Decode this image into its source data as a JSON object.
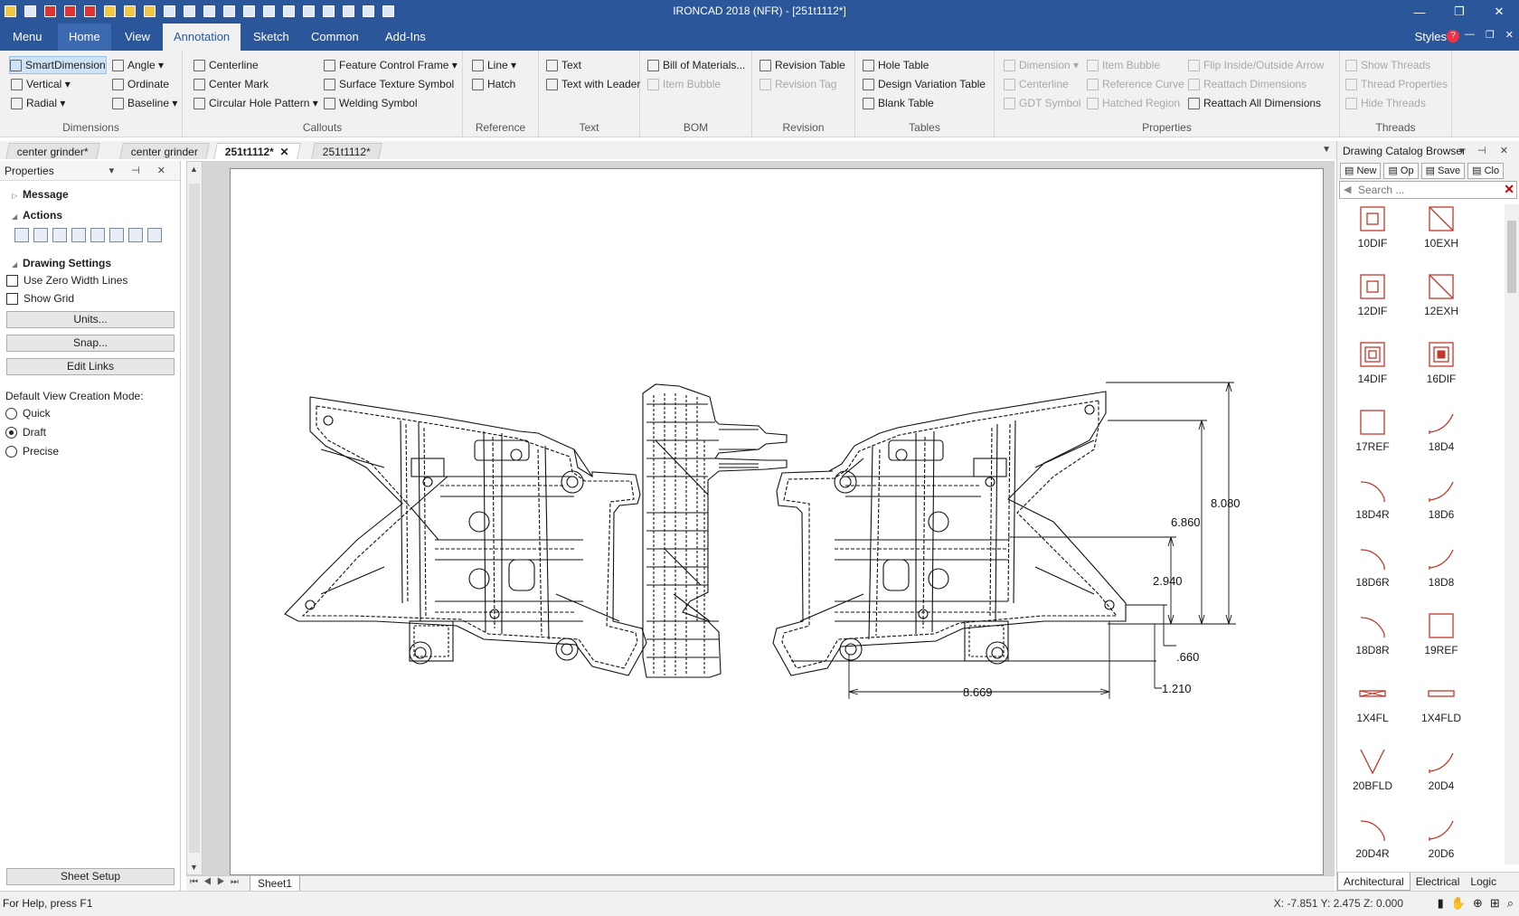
{
  "window": {
    "title": "IRONCAD 2018 (NFR) - [251t1112*]",
    "controls": [
      "—",
      "❐",
      "✕"
    ]
  },
  "menubar": {
    "tabs": [
      "Menu",
      "Home",
      "View",
      "Annotation",
      "Sketch",
      "Common",
      "Add-Ins"
    ],
    "active": "Annotation",
    "styles": "Styles",
    "help": "?",
    "mdi": [
      "—",
      "❐",
      "✕"
    ]
  },
  "ribbon": {
    "dimensions": {
      "label": "Dimensions",
      "items": [
        "SmartDimension",
        "Vertical",
        "Radial",
        "Angle",
        "Ordinate",
        "Baseline"
      ]
    },
    "callouts": {
      "label": "Callouts",
      "items": [
        "Centerline",
        "Center Mark",
        "Circular Hole Pattern",
        "Feature Control Frame",
        "Surface Texture Symbol",
        "Welding Symbol"
      ]
    },
    "reference": {
      "label": "Reference",
      "items": [
        "Line",
        "Hatch"
      ]
    },
    "text": {
      "label": "Text",
      "items": [
        "Text",
        "Text with Leader"
      ]
    },
    "bom": {
      "label": "BOM",
      "items": [
        "Bill of Materials...",
        "Item Bubble"
      ]
    },
    "revision": {
      "label": "Revision",
      "items": [
        "Revision Table",
        "Revision Tag"
      ]
    },
    "tables": {
      "label": "Tables",
      "items": [
        "Hole Table",
        "Design Variation Table",
        "Blank Table"
      ]
    },
    "properties": {
      "label": "Properties",
      "items": [
        "Dimension",
        "Centerline",
        "GDT Symbol",
        "Item Bubble",
        "Reference Curve",
        "Hatched Region",
        "Flip Inside/Outside Arrow",
        "Reattach Dimensions",
        "Reattach All Dimensions"
      ]
    },
    "threads": {
      "label": "Threads",
      "items": [
        "Show Threads",
        "Thread Properties",
        "Hide Threads"
      ]
    }
  },
  "doctabs": [
    "center grinder*",
    "center grinder",
    "251t1112*",
    "251t1112*"
  ],
  "properties": {
    "title": "Properties",
    "message": "Message",
    "actions": "Actions",
    "drawing_settings": "Drawing Settings",
    "use_zero_width": "Use Zero Width Lines",
    "show_grid": "Show Grid",
    "units_btn": "Units...",
    "snap_btn": "Snap...",
    "edit_links_btn": "Edit Links",
    "default_view_label": "Default View Creation Mode:",
    "modes": [
      "Quick",
      "Draft",
      "Precise"
    ],
    "selected_mode": "Draft",
    "sheet_setup_btn": "Sheet Setup"
  },
  "drawing": {
    "dims": [
      "8.080",
      "6.860",
      "2.940",
      ".660",
      "1.210",
      "8.669"
    ],
    "sheet_tab": "Sheet1"
  },
  "catalog": {
    "title": "Drawing Catalog Browser",
    "tools": [
      "New",
      "Op",
      "Save",
      "Clo"
    ],
    "search_placeholder": "Search ...",
    "items": [
      "10DIF",
      "10EXH",
      "12DIF",
      "12EXH",
      "14DIF",
      "16DIF",
      "17REF",
      "18D4",
      "18D4R",
      "18D6",
      "18D6R",
      "18D8",
      "18D8R",
      "19REF",
      "1X4FL",
      "1X4FLD",
      "20BFLD",
      "20D4",
      "20D4R",
      "20D6"
    ],
    "tabs": [
      "Architectural",
      "Electrical",
      "Logic"
    ],
    "accent": "#c0392b"
  },
  "status": {
    "help": "For Help, press F1",
    "coords": "X: -7.851 Y: 2.475 Z: 0.000"
  }
}
